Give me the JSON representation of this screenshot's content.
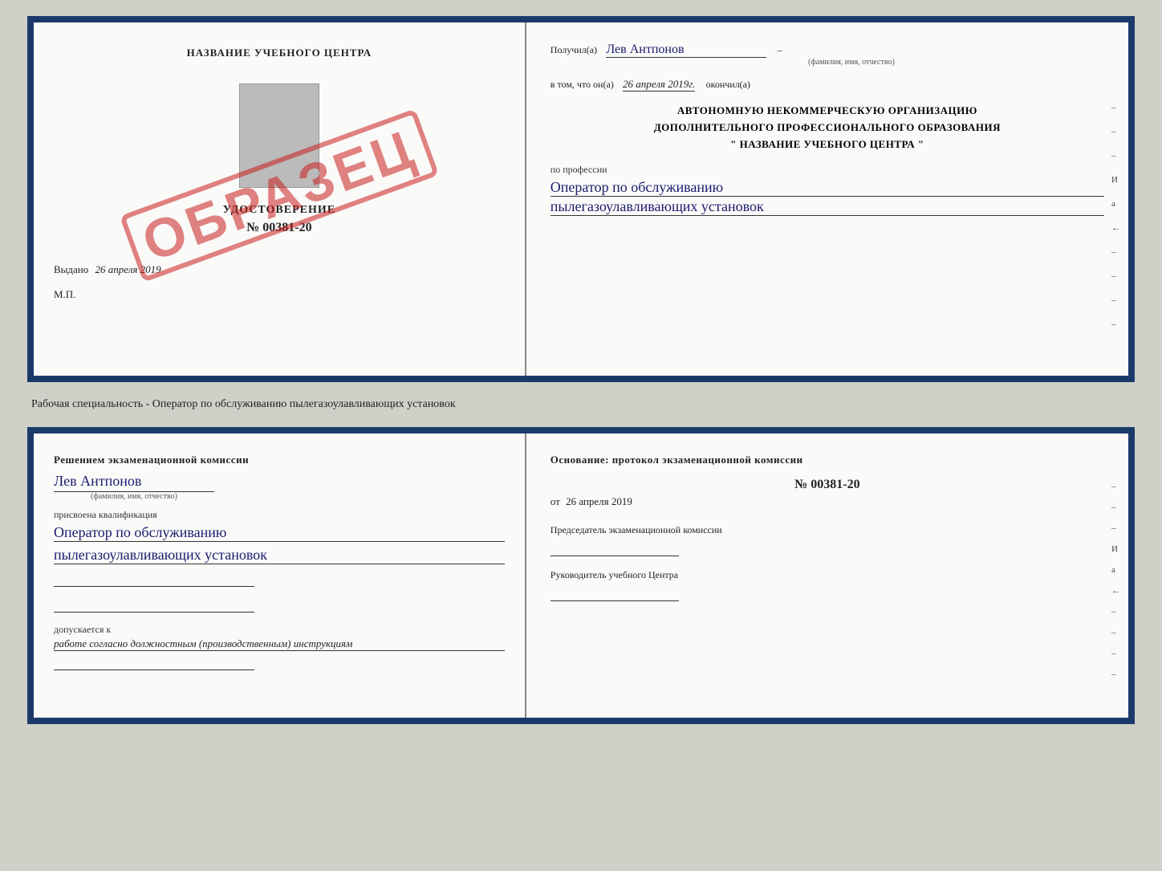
{
  "top_doc": {
    "left": {
      "title": "НАЗВАНИЕ УЧЕБНОГО ЦЕНТРА",
      "cert_type": "УДОСТОВЕРЕНИЕ",
      "cert_number": "№ 00381-20",
      "issued_date_label": "Выдано",
      "issued_date": "26 апреля 2019",
      "mp_label": "М.П.",
      "stamp_text": "ОБРАЗЕЦ"
    },
    "right": {
      "received_label": "Получил(а)",
      "recipient_name": "Лев Антпонов",
      "fio_label": "(фамилия, имя, отчество)",
      "in_that_label": "в том, что он(а)",
      "completion_date": "26 апреля 2019г.",
      "completed_label": "окончил(а)",
      "org_line1": "АВТОНОМНУЮ НЕКОММЕРЧЕСКУЮ ОРГАНИЗАЦИЮ",
      "org_line2": "ДОПОЛНИТЕЛЬНОГО ПРОФЕССИОНАЛЬНОГО ОБРАЗОВАНИЯ",
      "org_line3": "\" НАЗВАНИЕ УЧЕБНОГО ЦЕНТРА \"",
      "profession_label": "по профессии",
      "profession_line1": "Оператор по обслуживанию",
      "profession_line2": "пылегазоулавливающих установок"
    }
  },
  "caption": "Рабочая специальность - Оператор по обслуживанию пылегазоулавливающих установок",
  "bottom_doc": {
    "left": {
      "decision_label": "Решением экзаменационной комиссии",
      "person_name": "Лев Антпонов",
      "fio_label": "(фамилия, имя, отчество)",
      "qualification_label": "присвоена квалификация",
      "qualification_line1": "Оператор по обслуживанию",
      "qualification_line2": "пылегазоулавливающих установок",
      "allows_label": "допускается к",
      "allows_value": "работе согласно должностным (производственным) инструкциям"
    },
    "right": {
      "basis_label": "Основание: протокол экзаменационной комиссии",
      "protocol_number": "№  00381-20",
      "protocol_date_prefix": "от",
      "protocol_date": "26 апреля 2019",
      "chairman_label": "Председатель экзаменационной комиссии",
      "director_label": "Руководитель учебного Центра"
    }
  }
}
